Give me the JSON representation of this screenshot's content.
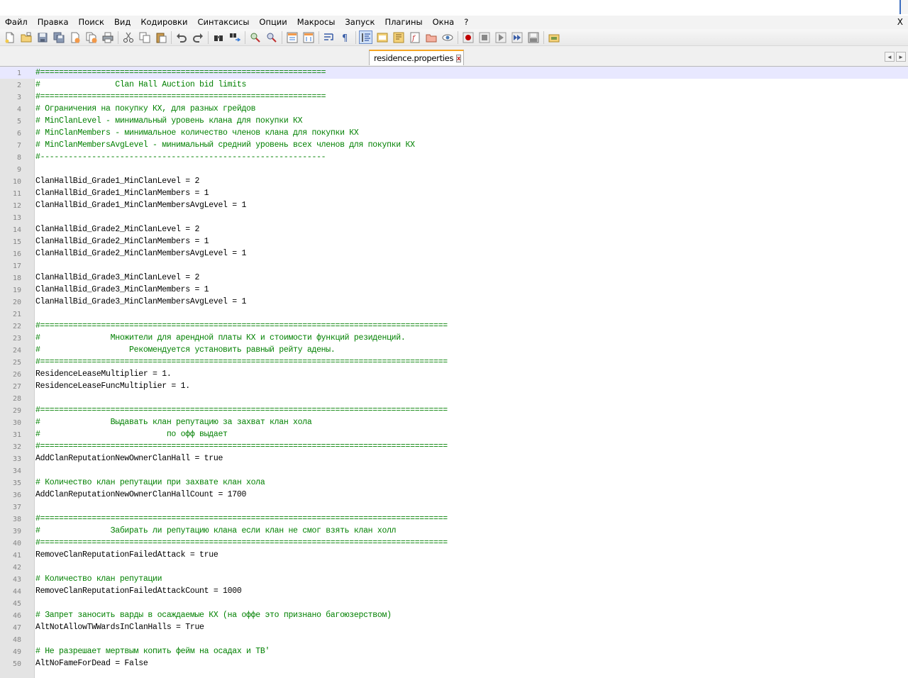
{
  "menu": {
    "items": [
      "Файл",
      "Правка",
      "Поиск",
      "Вид",
      "Кодировки",
      "Синтаксисы",
      "Опции",
      "Макросы",
      "Запуск",
      "Плагины",
      "Окна",
      "?"
    ],
    "close_label": "X"
  },
  "toolbar": {
    "icons": [
      "new-file-icon",
      "open-file-icon",
      "save-icon",
      "save-all-icon",
      "close-file-icon",
      "close-all-icon",
      "print-icon",
      "cut-icon",
      "copy-icon",
      "paste-icon",
      "undo-icon",
      "redo-icon",
      "find-icon",
      "replace-icon",
      "zoom-in-icon",
      "zoom-out-icon",
      "sync-vertical-icon",
      "sync-horizontal-icon",
      "wrap-icon",
      "show-all-chars-icon",
      "indent-guide-icon",
      "user-language-icon",
      "doc-map-icon",
      "function-list-icon",
      "folder-workspace-icon",
      "monitor-icon",
      "record-macro-icon",
      "stop-record-icon",
      "play-macro-icon",
      "run-macro-multiple-icon",
      "save-macro-icon",
      "plugin-icon"
    ]
  },
  "tab": {
    "label": "residence.properties",
    "close_symbol": "x",
    "arrow_left": "◄",
    "arrow_right": "►"
  },
  "editor": {
    "current_line": 1,
    "lines": [
      {
        "n": "1",
        "text": "#=============================================================",
        "type": "comment"
      },
      {
        "n": "2",
        "text": "#                Clan Hall Auction bid limits",
        "type": "comment"
      },
      {
        "n": "3",
        "text": "#=============================================================",
        "type": "comment"
      },
      {
        "n": "4",
        "text": "# Ограничения на покупку КХ, для разных грейдов",
        "type": "comment"
      },
      {
        "n": "5",
        "text": "# MinClanLevel - минимальный уровень клана для покупки КХ",
        "type": "comment"
      },
      {
        "n": "6",
        "text": "# MinClanMembers - минимальное количество членов клана для покупки КХ",
        "type": "comment"
      },
      {
        "n": "7",
        "text": "# MinClanMembersAvgLevel - минимальный средний уровень всех членов для покупки КХ",
        "type": "comment"
      },
      {
        "n": "8",
        "text": "#-------------------------------------------------------------",
        "type": "comment"
      },
      {
        "n": "9",
        "text": "",
        "type": "code"
      },
      {
        "n": "10",
        "text": "ClanHallBid_Grade1_MinClanLevel = 2",
        "type": "code"
      },
      {
        "n": "11",
        "text": "ClanHallBid_Grade1_MinClanMembers = 1",
        "type": "code"
      },
      {
        "n": "12",
        "text": "ClanHallBid_Grade1_MinClanMembersAvgLevel = 1",
        "type": "code"
      },
      {
        "n": "13",
        "text": "",
        "type": "code"
      },
      {
        "n": "14",
        "text": "ClanHallBid_Grade2_MinClanLevel = 2",
        "type": "code"
      },
      {
        "n": "15",
        "text": "ClanHallBid_Grade2_MinClanMembers = 1",
        "type": "code"
      },
      {
        "n": "16",
        "text": "ClanHallBid_Grade2_MinClanMembersAvgLevel = 1",
        "type": "code"
      },
      {
        "n": "17",
        "text": "",
        "type": "code"
      },
      {
        "n": "18",
        "text": "ClanHallBid_Grade3_MinClanLevel = 2",
        "type": "code"
      },
      {
        "n": "19",
        "text": "ClanHallBid_Grade3_MinClanMembers = 1",
        "type": "code"
      },
      {
        "n": "20",
        "text": "ClanHallBid_Grade3_MinClanMembersAvgLevel = 1",
        "type": "code"
      },
      {
        "n": "21",
        "text": "",
        "type": "code"
      },
      {
        "n": "22",
        "text": "#=======================================================================================",
        "type": "comment"
      },
      {
        "n": "23",
        "text": "#               Множители для арендной платы КХ и стоимости функций резиденций.",
        "type": "comment"
      },
      {
        "n": "24",
        "text": "#                   Рекомендуется установить равный рейту адены.",
        "type": "comment"
      },
      {
        "n": "25",
        "text": "#=======================================================================================",
        "type": "comment"
      },
      {
        "n": "26",
        "text": "ResidenceLeaseMultiplier = 1.",
        "type": "code"
      },
      {
        "n": "27",
        "text": "ResidenceLeaseFuncMultiplier = 1.",
        "type": "code"
      },
      {
        "n": "28",
        "text": "",
        "type": "code"
      },
      {
        "n": "29",
        "text": "#=======================================================================================",
        "type": "comment"
      },
      {
        "n": "30",
        "text": "#               Выдавать клан репутацию за захват клан хола",
        "type": "comment"
      },
      {
        "n": "31",
        "text": "#                           по офф выдает",
        "type": "comment"
      },
      {
        "n": "32",
        "text": "#=======================================================================================",
        "type": "comment"
      },
      {
        "n": "33",
        "text": "AddClanReputationNewOwnerClanHall = true",
        "type": "code"
      },
      {
        "n": "34",
        "text": "",
        "type": "code"
      },
      {
        "n": "35",
        "text": "# Количество клан репутации при захвате клан хола",
        "type": "comment"
      },
      {
        "n": "36",
        "text": "AddClanReputationNewOwnerClanHallCount = 1700",
        "type": "code"
      },
      {
        "n": "37",
        "text": "",
        "type": "code"
      },
      {
        "n": "38",
        "text": "#=======================================================================================",
        "type": "comment"
      },
      {
        "n": "39",
        "text": "#               Забирать ли репутацию клана если клан не смог взять клан холл",
        "type": "comment"
      },
      {
        "n": "40",
        "text": "#=======================================================================================",
        "type": "comment"
      },
      {
        "n": "41",
        "text": "RemoveClanReputationFailedAttack = true",
        "type": "code"
      },
      {
        "n": "42",
        "text": "",
        "type": "code"
      },
      {
        "n": "43",
        "text": "# Количество клан репутации",
        "type": "comment"
      },
      {
        "n": "44",
        "text": "RemoveClanReputationFailedAttackCount = 1000",
        "type": "code"
      },
      {
        "n": "45",
        "text": "",
        "type": "code"
      },
      {
        "n": "46",
        "text": "# Запрет заносить варды в осаждаемые КХ (на оффе это признано багоюзерством)",
        "type": "comment"
      },
      {
        "n": "47",
        "text": "AltNotAllowTWWardsInClanHalls = True",
        "type": "code"
      },
      {
        "n": "48",
        "text": "",
        "type": "code"
      },
      {
        "n": "49",
        "text": "# Не разрешает мертвым копить фейм на осадах и ТВ'",
        "type": "comment"
      },
      {
        "n": "50",
        "text": "AltNoFameForDead = False",
        "type": "code"
      }
    ]
  }
}
